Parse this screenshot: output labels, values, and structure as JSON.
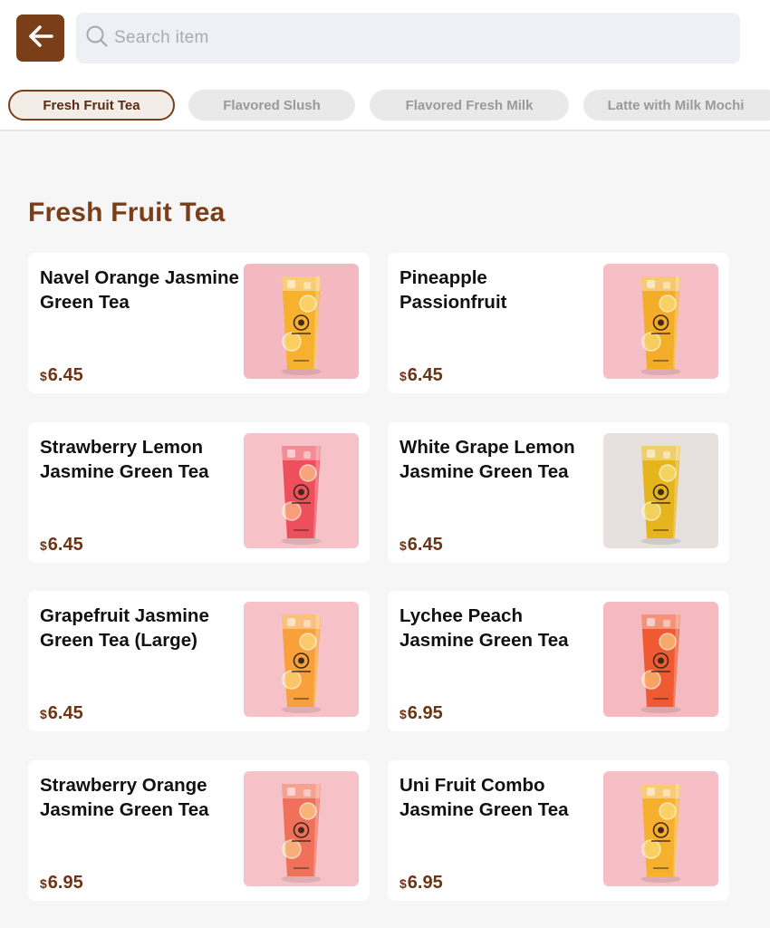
{
  "search": {
    "placeholder": "Search item"
  },
  "tabs": [
    {
      "label": "Fresh Fruit Tea",
      "active": true
    },
    {
      "label": "Flavored Slush",
      "active": false
    },
    {
      "label": "Flavored Fresh Milk",
      "active": false
    },
    {
      "label": "Latte with Milk Mochi",
      "active": false
    }
  ],
  "section": {
    "title": "Fresh Fruit Tea"
  },
  "currency_symbol": "$",
  "items": [
    {
      "name": "Navel Orange Jasmine Green Tea",
      "price": "6.45",
      "bg": "#f4b9c0",
      "drink": "#f6b22e",
      "icon": "cup-drink-icon"
    },
    {
      "name": "Pineapple Passionfruit",
      "price": "6.45",
      "bg": "#f6bfc6",
      "drink": "#f3ad28",
      "icon": "cup-drink-icon"
    },
    {
      "name": "Strawberry Lemon Jasmine Green Tea",
      "price": "6.45",
      "bg": "#f6c2c8",
      "drink": "#ee4f5c",
      "icon": "cup-drink-icon"
    },
    {
      "name": "White Grape Lemon Jasmine Green Tea",
      "price": "6.45",
      "bg": "#e6e1de",
      "drink": "#e6b51e",
      "icon": "cup-drink-icon"
    },
    {
      "name": "Grapefruit Jasmine Green Tea (Large)",
      "price": "6.45",
      "bg": "#f6c2c8",
      "drink": "#f8a03a",
      "icon": "cup-drink-icon"
    },
    {
      "name": "Lychee Peach Jasmine Green Tea",
      "price": "6.95",
      "bg": "#f5b9c0",
      "drink": "#ef5a33",
      "icon": "cup-drink-icon"
    },
    {
      "name": "Strawberry Orange Jasmine Green Tea",
      "price": "6.95",
      "bg": "#f6c2c8",
      "drink": "#f0705a",
      "icon": "cup-drink-icon"
    },
    {
      "name": "Uni Fruit Combo Jasmine Green Tea",
      "price": "6.95",
      "bg": "#f6bec5",
      "drink": "#f7b02e",
      "icon": "cup-drink-icon"
    }
  ],
  "colors": {
    "accent": "#7a3f19",
    "price": "#6b3415"
  }
}
